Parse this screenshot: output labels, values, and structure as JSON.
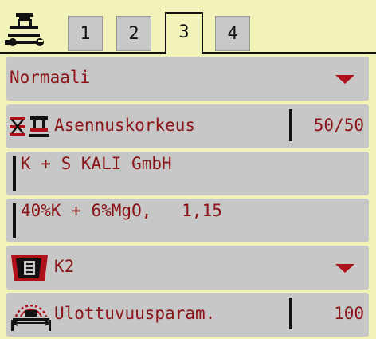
{
  "header": {
    "settings_icon": "spreader-wrench-icon",
    "tabs": [
      {
        "label": "1",
        "active": false
      },
      {
        "label": "2",
        "active": false
      },
      {
        "label": "3",
        "active": true
      },
      {
        "label": "4",
        "active": false
      }
    ]
  },
  "rows": {
    "mode": {
      "value": "Normaali",
      "icon": "chevron-down-icon"
    },
    "mounting_height": {
      "label": "Asennuskorkeus",
      "value": "50/50",
      "icon": "mounting-height-icon"
    },
    "manufacturer": {
      "value": "K + S KALI GmbH"
    },
    "fertilizer": {
      "value": "40%K + 6%MgO,   1,15"
    },
    "spreading_disc": {
      "value": "K2",
      "icon": "spreading-disc-icon"
    },
    "range_param": {
      "label": "Ulottuvuusparam.",
      "value": "100",
      "icon": "spread-range-icon"
    }
  },
  "colors": {
    "background": "#f2f3b9",
    "row": "#c7c7c7",
    "text": "#8b1418",
    "accent": "#b0101a"
  }
}
